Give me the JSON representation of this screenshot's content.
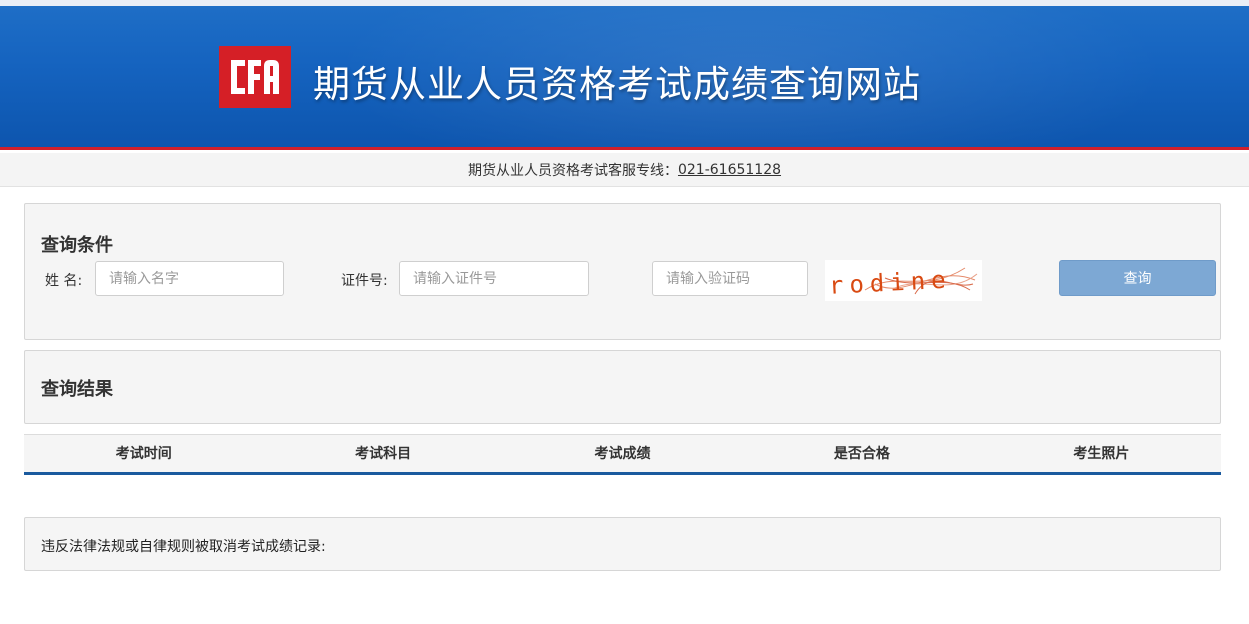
{
  "header": {
    "logo_text": "CFA",
    "site_title": "期货从业人员资格考试成绩查询网站",
    "brand_red": "#d51f26",
    "banner_blue": "#1563bf"
  },
  "hotline": {
    "label": "期货从业人员资格考试客服专线：",
    "number": "021-61651128"
  },
  "query_panel": {
    "heading": "查询条件",
    "name_label": "姓 名:",
    "name_placeholder": "请输入名字",
    "id_label": "证件号:",
    "id_placeholder": "请输入证件号",
    "captcha_placeholder": "请输入验证码",
    "captcha_text": "rodine",
    "query_button": "查询",
    "button_color": "#7da8d4"
  },
  "result_panel": {
    "heading": "查询结果",
    "columns": [
      "考试时间",
      "考试科目",
      "考试成绩",
      "是否合格",
      "考生照片"
    ]
  },
  "revoke_panel": {
    "text": "违反法律法规或自律规则被取消考试成绩记录:"
  }
}
